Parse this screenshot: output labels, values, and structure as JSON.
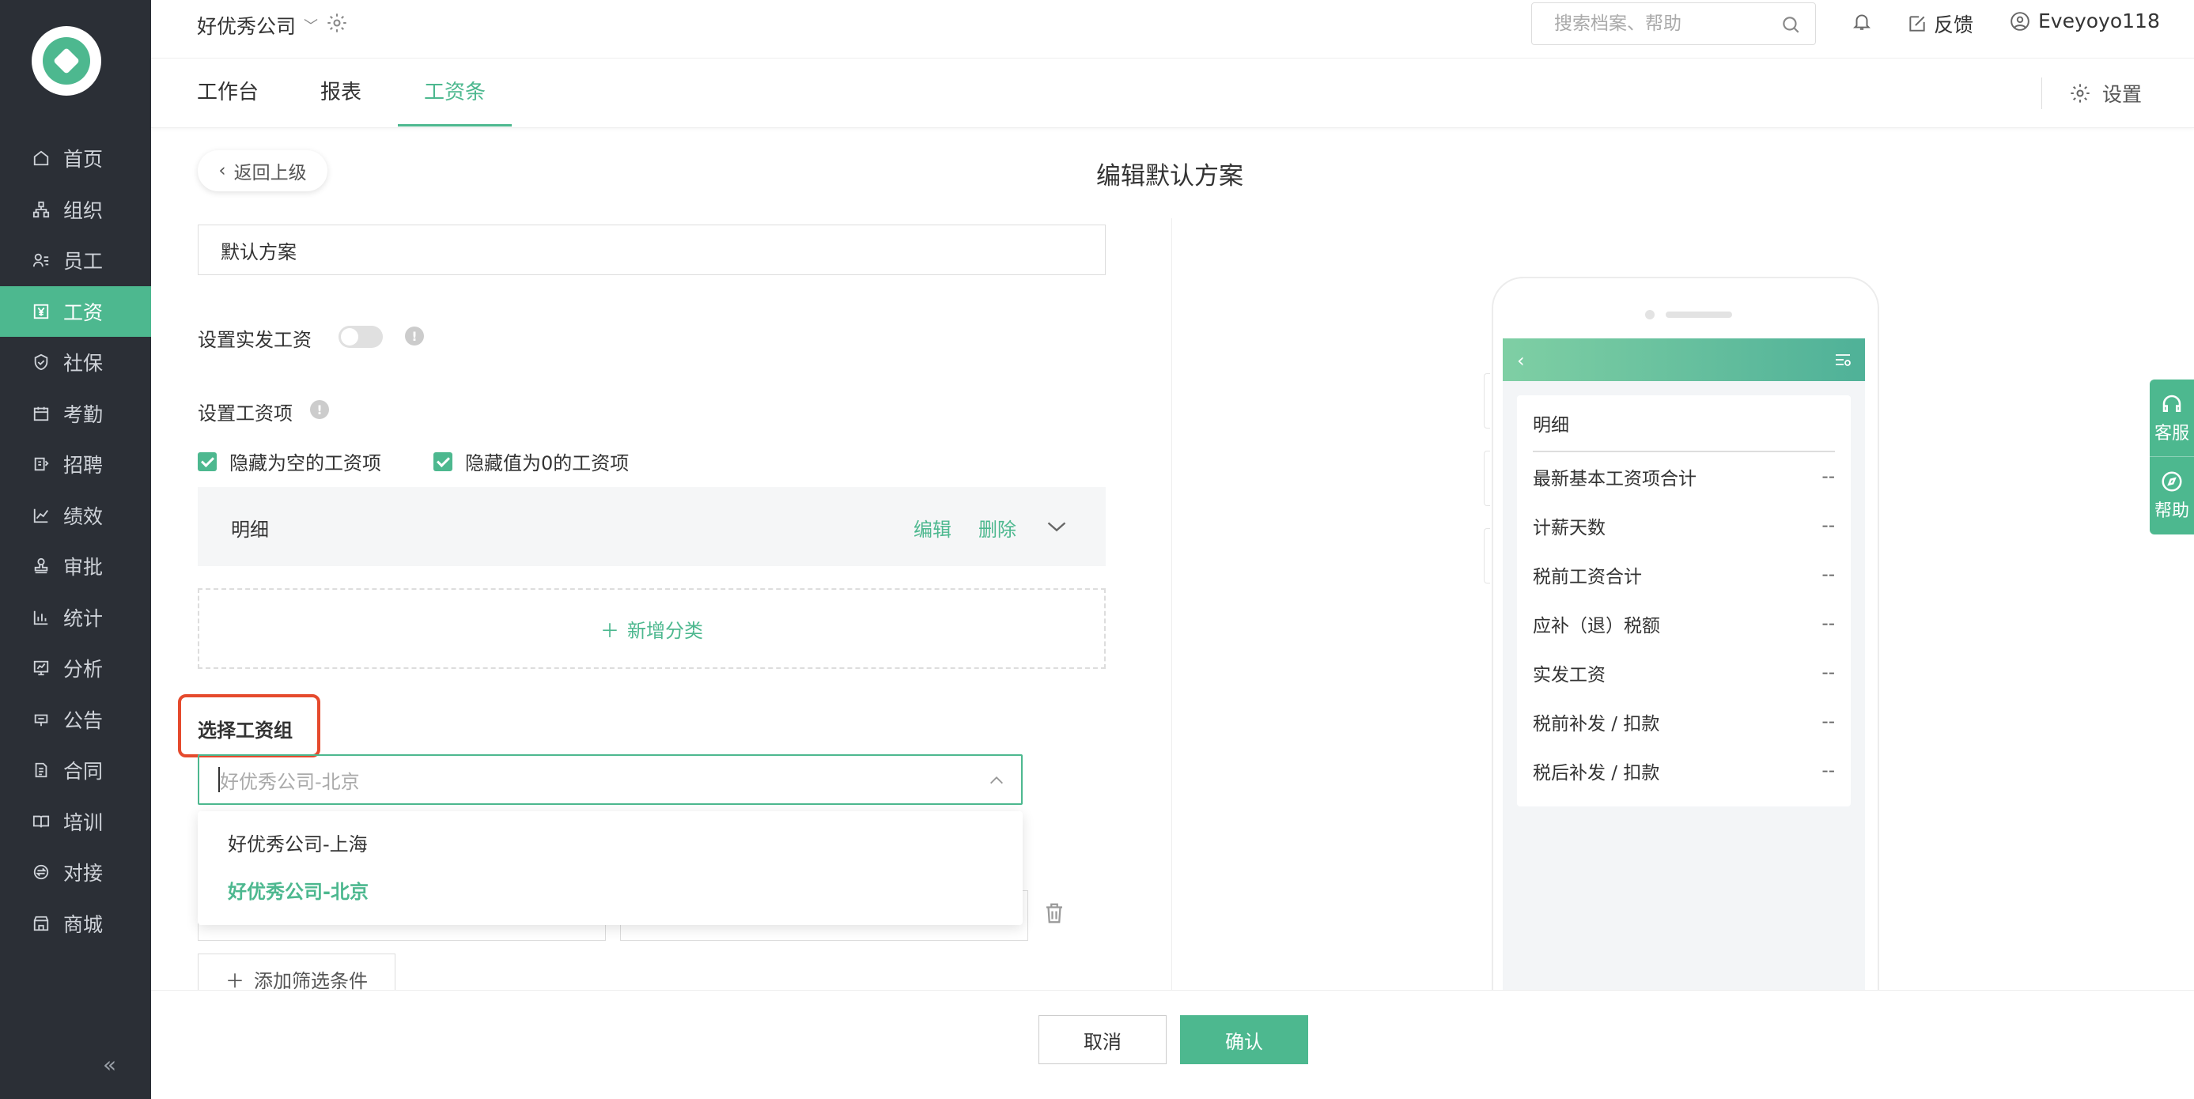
{
  "sidebar": {
    "items": [
      {
        "label": "首页",
        "icon": "home-icon"
      },
      {
        "label": "组织",
        "icon": "org-icon"
      },
      {
        "label": "员工",
        "icon": "employee-icon"
      },
      {
        "label": "工资",
        "icon": "salary-icon",
        "active": true
      },
      {
        "label": "社保",
        "icon": "shield-icon"
      },
      {
        "label": "考勤",
        "icon": "calendar-icon"
      },
      {
        "label": "招聘",
        "icon": "recruit-icon"
      },
      {
        "label": "绩效",
        "icon": "chart-line-icon"
      },
      {
        "label": "审批",
        "icon": "stamp-icon"
      },
      {
        "label": "统计",
        "icon": "bar-chart-icon"
      },
      {
        "label": "分析",
        "icon": "analysis-icon"
      },
      {
        "label": "公告",
        "icon": "notice-icon"
      },
      {
        "label": "合同",
        "icon": "contract-icon"
      },
      {
        "label": "培训",
        "icon": "book-icon"
      },
      {
        "label": "对接",
        "icon": "link-icon"
      },
      {
        "label": "商城",
        "icon": "store-icon"
      }
    ]
  },
  "header": {
    "company": "好优秀公司",
    "search_placeholder": "搜索档案、帮助",
    "feedback": "反馈",
    "username": "Eveyoyo118"
  },
  "tabs": {
    "items": [
      "工作台",
      "报表",
      "工资条"
    ],
    "active": "工资条",
    "settings": "设置"
  },
  "page": {
    "back": "返回上级",
    "title": "编辑默认方案",
    "scheme_name": "默认方案",
    "set_actual_pay": "设置实发工资",
    "set_items": "设置工资项",
    "hide_empty": "隐藏为空的工资项",
    "hide_zero": "隐藏值为0的工资项",
    "detail": {
      "label": "明细",
      "edit": "编辑",
      "delete": "删除"
    },
    "add_category": "新增分类",
    "select_group_label": "选择工资组",
    "select_placeholder": "好优秀公司-北京",
    "dropdown": [
      "好优秀公司-上海",
      "好优秀公司-北京"
    ],
    "add_filter": "添加筛选条件"
  },
  "footer": {
    "cancel": "取消",
    "confirm": "确认"
  },
  "preview": {
    "card_title": "明细",
    "rows": [
      {
        "label": "最新基本工资项合计",
        "value": "--"
      },
      {
        "label": "计薪天数",
        "value": "--"
      },
      {
        "label": "税前工资合计",
        "value": "--"
      },
      {
        "label": "应补（退）税额",
        "value": "--"
      },
      {
        "label": "实发工资",
        "value": "--"
      },
      {
        "label": "税前补发 / 扣款",
        "value": "--"
      },
      {
        "label": "税后补发 / 扣款",
        "value": "--"
      }
    ]
  },
  "float": {
    "service": "客服",
    "help": "帮助"
  },
  "colors": {
    "accent": "#4db88f",
    "sidebar": "#2b2f36",
    "highlight": "#e54a2d"
  }
}
